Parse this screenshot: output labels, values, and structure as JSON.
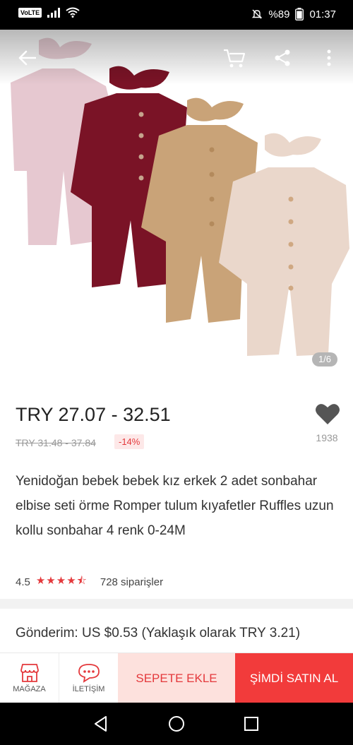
{
  "status_bar": {
    "volte": "VoLTE",
    "battery": "%89",
    "time": "01:37"
  },
  "gallery": {
    "counter": "1/6",
    "image_description_colors": [
      "#e6c8d0",
      "#7a1326",
      "#c9a378",
      "#ead7cb"
    ]
  },
  "product": {
    "price": "TRY 27.07 - 32.51",
    "old_price": "TRY 31.48 - 37.84",
    "discount": "-14%",
    "likes": "1938",
    "title": "Yenidoğan bebek bebek kız erkek 2 adet sonbahar elbise seti örme Romper tulum kıyafetler Ruffles uzun kollu sonbahar 4 renk 0-24M",
    "rating": "4.5",
    "stars": "★★★★⯪",
    "orders": "728 siparişler",
    "shipping": "Gönderim: US $0.53 (Yaklaşık olarak TRY 3.21)"
  },
  "actions": {
    "store_label": "MAĞAZA",
    "contact_label": "İLETİŞİM",
    "add_to_cart": "SEPETE EKLE",
    "buy_now": "ŞİMDİ SATIN AL"
  },
  "colors": {
    "accent": "#e4393c",
    "buy_button": "#f23b3b",
    "cart_button_bg": "#fde1dd"
  }
}
